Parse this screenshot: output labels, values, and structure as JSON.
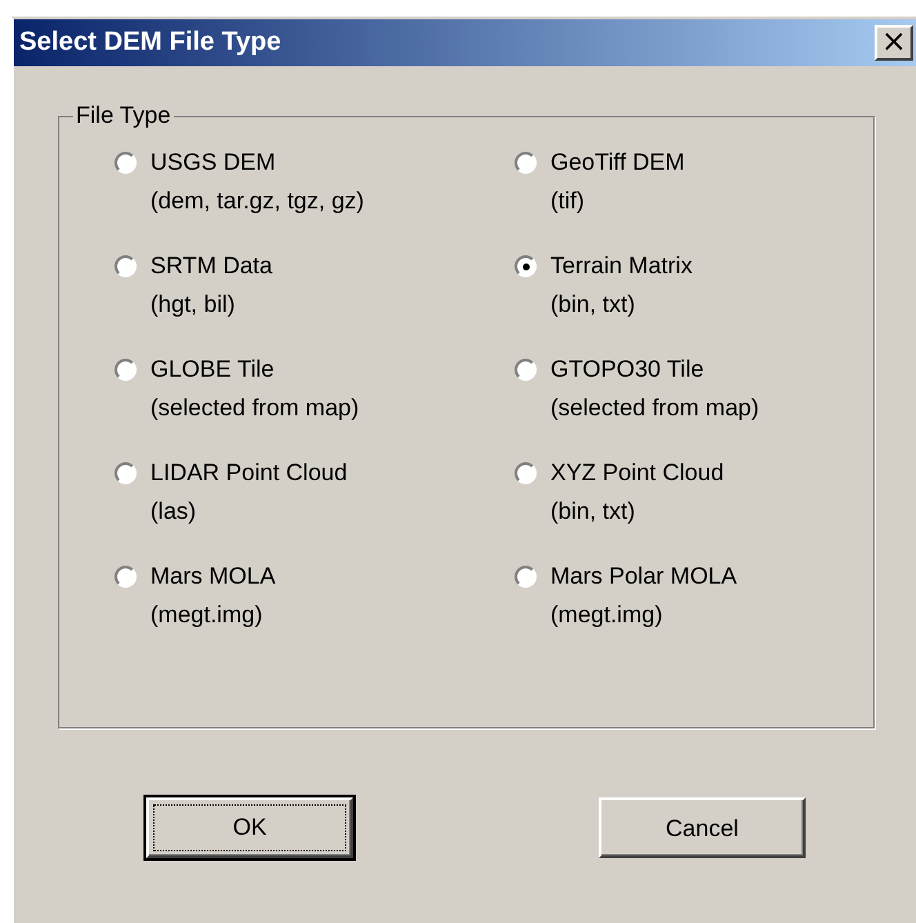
{
  "window": {
    "title": "Select DEM File Type",
    "close": "×"
  },
  "group": {
    "label": "File Type",
    "options": [
      {
        "name": "USGS DEM",
        "extensions": "(dem, tar.gz, tgz, gz)",
        "selected": false
      },
      {
        "name": "GeoTiff DEM",
        "extensions": "(tif)",
        "selected": false
      },
      {
        "name": "SRTM Data",
        "extensions": "(hgt, bil)",
        "selected": false
      },
      {
        "name": "Terrain Matrix",
        "extensions": "(bin, txt)",
        "selected": true
      },
      {
        "name": "GLOBE Tile",
        "extensions": "(selected from map)",
        "selected": false
      },
      {
        "name": "GTOPO30 Tile",
        "extensions": "(selected from map)",
        "selected": false
      },
      {
        "name": "LIDAR Point Cloud",
        "extensions": "(las)",
        "selected": false
      },
      {
        "name": "XYZ Point Cloud",
        "extensions": "(bin, txt)",
        "selected": false
      },
      {
        "name": "Mars MOLA",
        "extensions": "(megt.img)",
        "selected": false
      },
      {
        "name": "Mars Polar MOLA",
        "extensions": "(megt.img)",
        "selected": false
      }
    ]
  },
  "buttons": [
    {
      "label": "OK",
      "default": true
    },
    {
      "label": "Cancel",
      "default": false
    }
  ]
}
